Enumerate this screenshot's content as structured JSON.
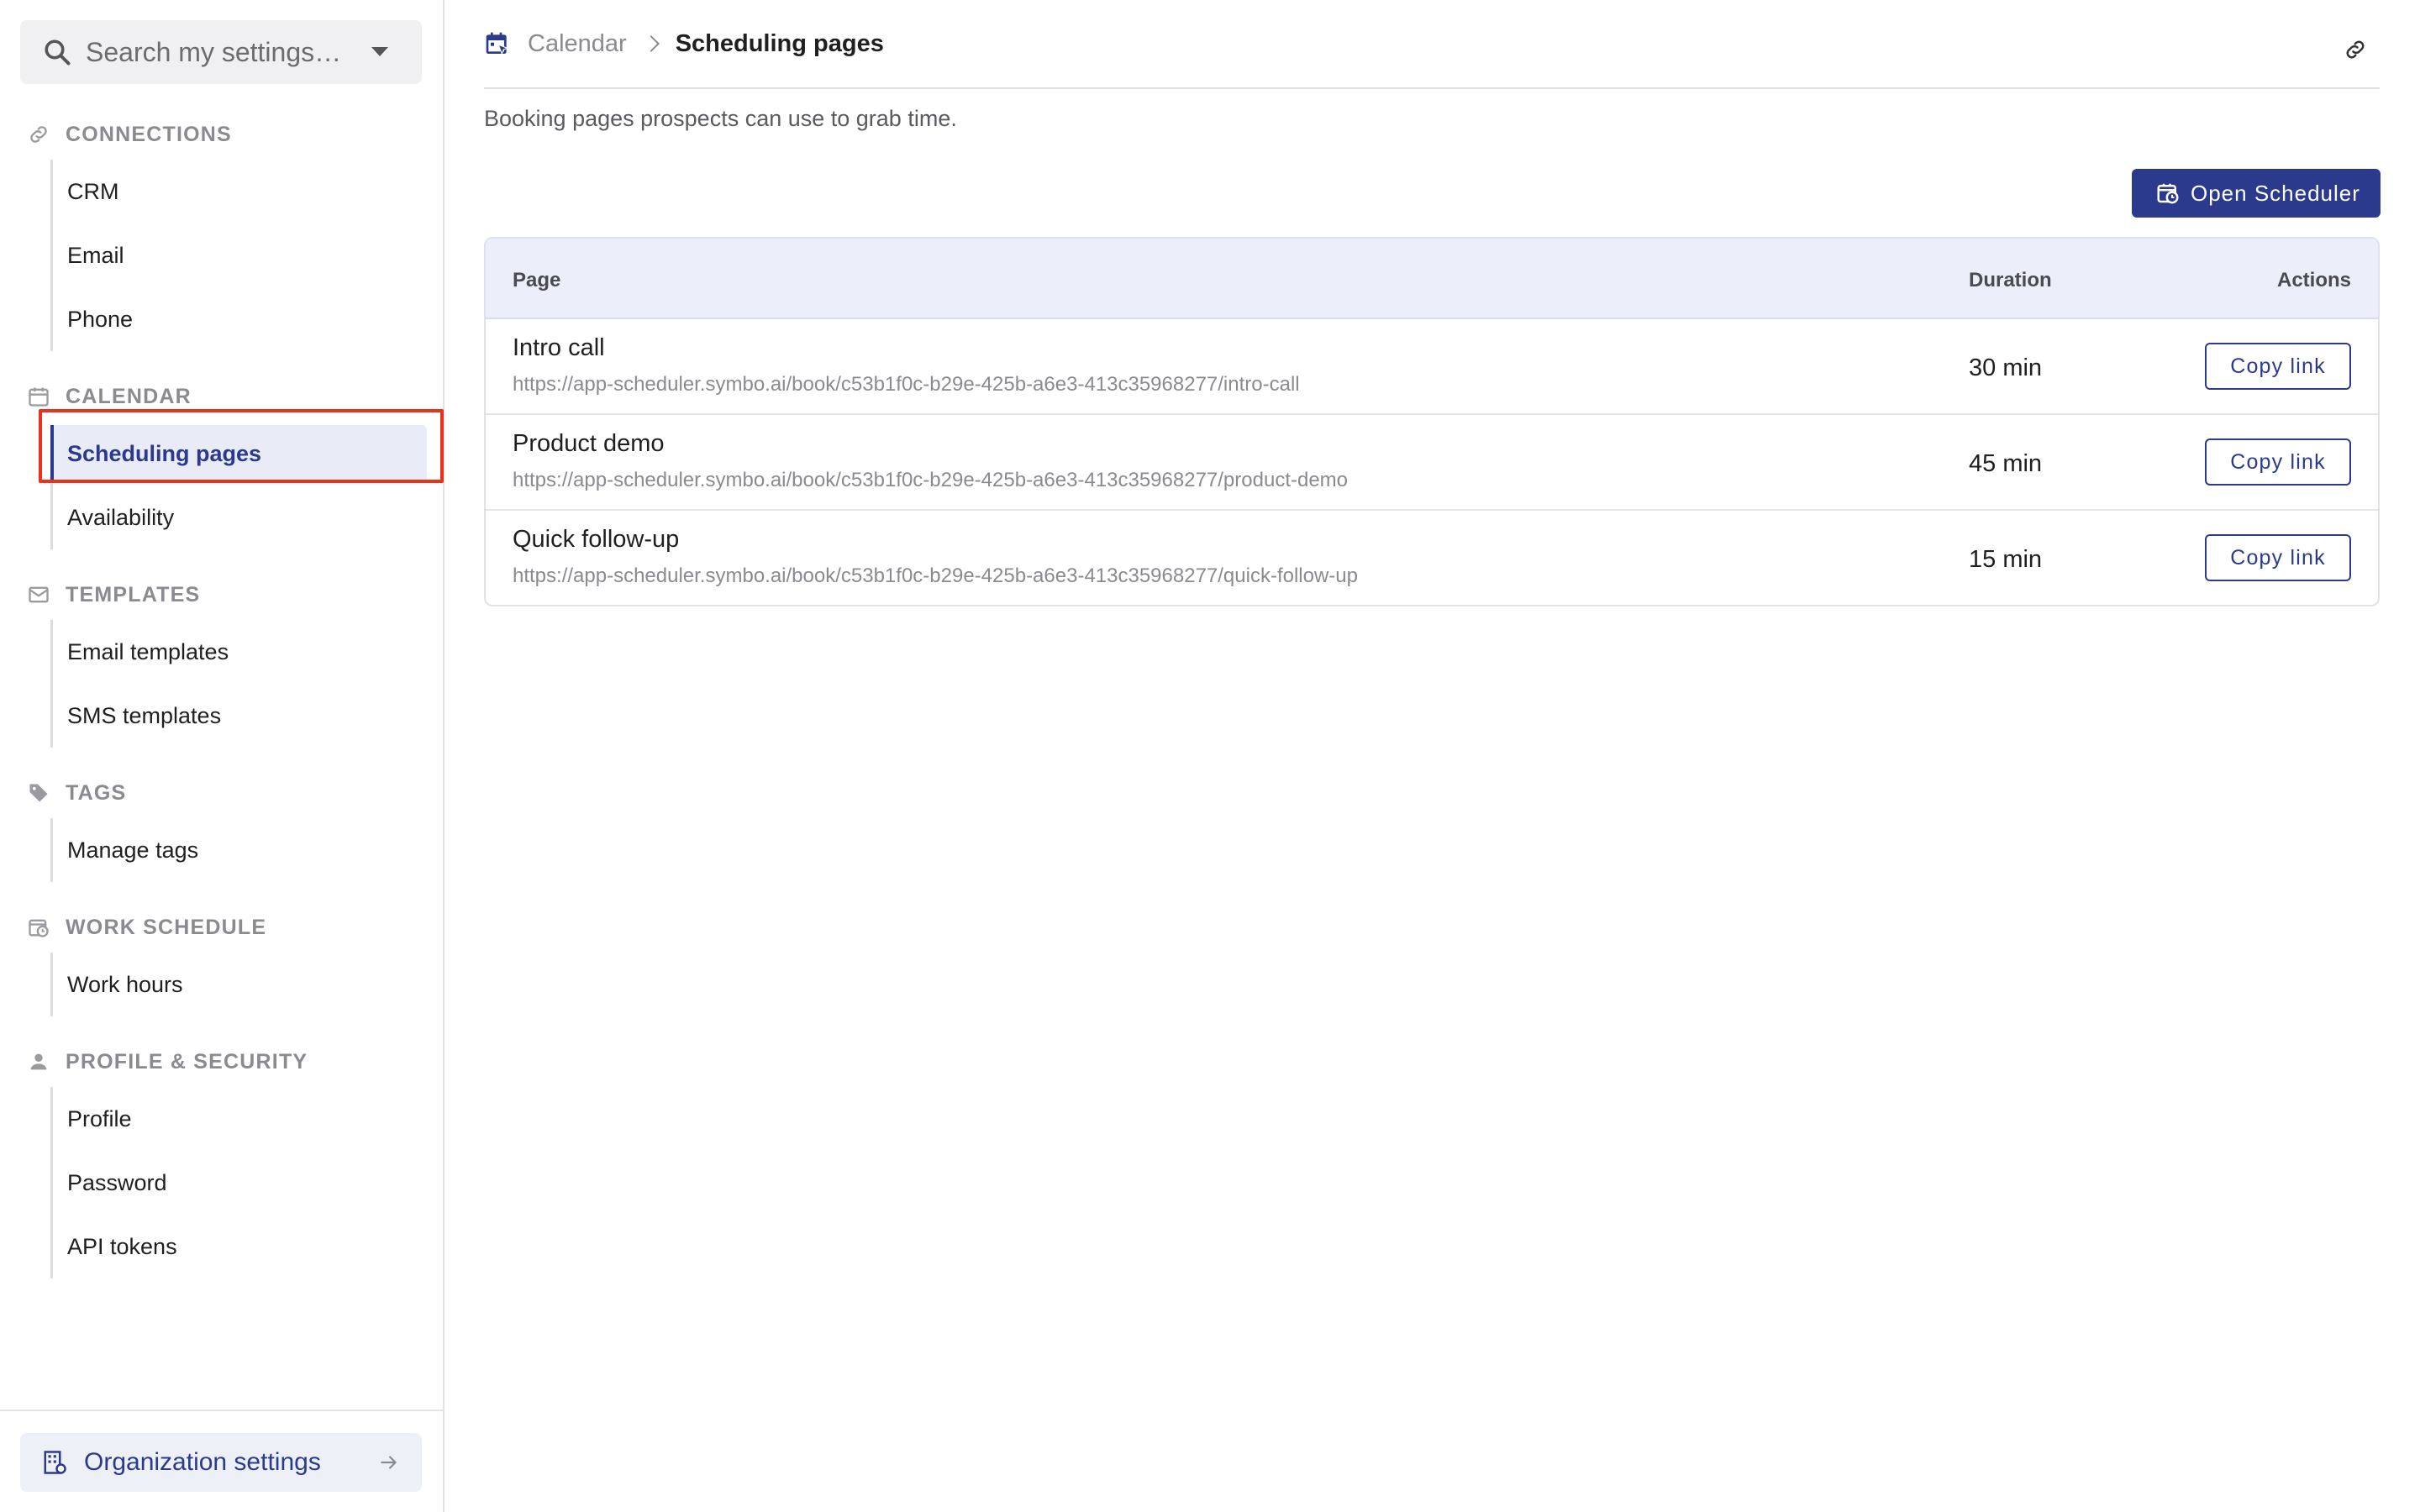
{
  "search": {
    "placeholder": "Search my settings…"
  },
  "sidebar": {
    "sections": [
      {
        "title": "CONNECTIONS",
        "icon": "link-icon",
        "items": [
          "CRM",
          "Email",
          "Phone"
        ]
      },
      {
        "title": "CALENDAR",
        "icon": "calendar-icon",
        "items": [
          "Scheduling pages",
          "Availability"
        ],
        "active": "Scheduling pages"
      },
      {
        "title": "TEMPLATES",
        "icon": "templates-icon",
        "items": [
          "Email templates",
          "SMS templates"
        ]
      },
      {
        "title": "TAGS",
        "icon": "tag-icon",
        "items": [
          "Manage tags"
        ]
      },
      {
        "title": "WORK SCHEDULE",
        "icon": "calendar-clock-icon",
        "items": [
          "Work hours"
        ]
      },
      {
        "title": "PROFILE & SECURITY",
        "icon": "person-icon",
        "items": [
          "Profile",
          "Password",
          "API tokens"
        ]
      }
    ],
    "footer": {
      "org_label": "Organization settings"
    }
  },
  "header": {
    "breadcrumb_parent": "Calendar",
    "breadcrumb_current": "Scheduling pages",
    "subtitle": "Booking pages prospects can use to grab time."
  },
  "toolbar": {
    "open_scheduler_label": "Open Scheduler"
  },
  "table": {
    "columns": {
      "page": "Page",
      "duration": "Duration",
      "actions": "Actions"
    },
    "rows": [
      {
        "name": "Intro call",
        "url": "https://app-scheduler.symbo.ai/book/c53b1f0c-b29e-425b-a6e3-413c35968277/intro-call",
        "duration": "30 min",
        "action": "Copy link"
      },
      {
        "name": "Product demo",
        "url": "https://app-scheduler.symbo.ai/book/c53b1f0c-b29e-425b-a6e3-413c35968277/product-demo",
        "duration": "45 min",
        "action": "Copy link"
      },
      {
        "name": "Quick follow-up",
        "url": "https://app-scheduler.symbo.ai/book/c53b1f0c-b29e-425b-a6e3-413c35968277/quick-follow-up",
        "duration": "15 min",
        "action": "Copy link"
      }
    ]
  },
  "colors": {
    "accent": "#2b3a8c",
    "highlight": "#e8321c",
    "header_bg": "#eceef9"
  }
}
